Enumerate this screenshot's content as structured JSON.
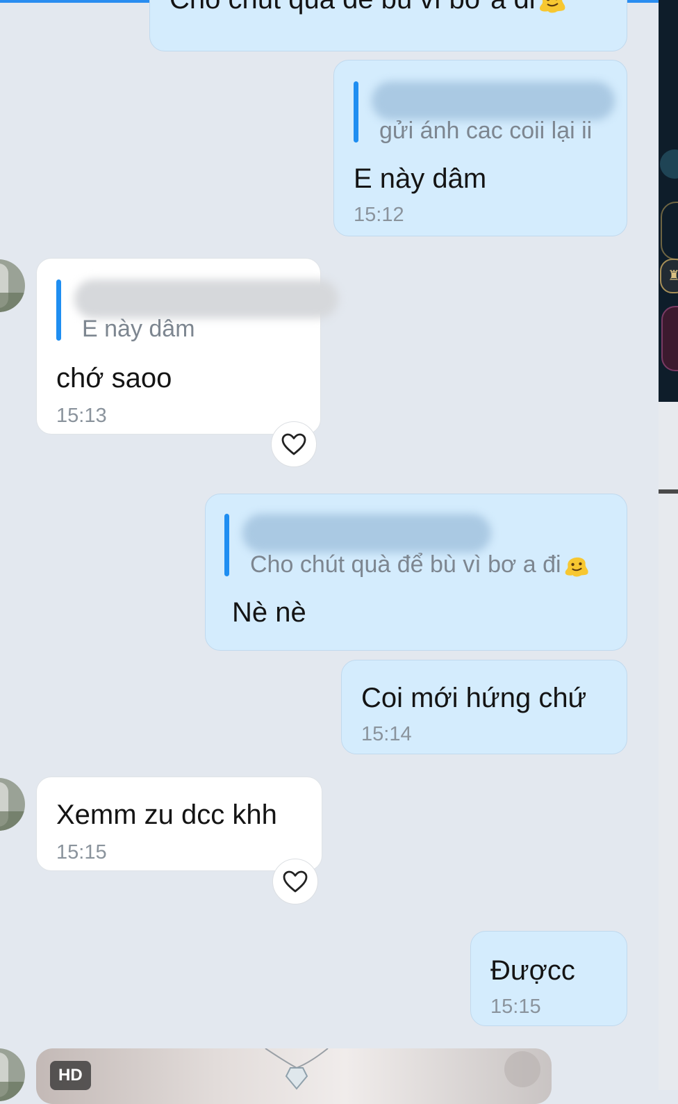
{
  "messages": [
    {
      "side": "sent",
      "text": "Cho chút quà để bù vì bơ a đi",
      "emoji": "melting-face-emoji"
    },
    {
      "side": "sent",
      "reply_to": "gửi ánh cac coii lại ii",
      "text": "E này dâm",
      "time": "15:12"
    },
    {
      "side": "received",
      "reply_to": "E này dâm",
      "text": "chớ saoo",
      "time": "15:13",
      "reaction_icon": "heart-icon"
    },
    {
      "side": "sent",
      "reply_to": "Cho chút quà để bù vì bơ a đi",
      "reply_emoji": "melting-face-emoji",
      "text": "Nè nè"
    },
    {
      "side": "sent",
      "text": "Coi mới hứng chứ",
      "time": "15:14"
    },
    {
      "side": "received",
      "text": "Xemm zu dcc khh",
      "time": "15:15",
      "reaction_icon": "heart-icon"
    },
    {
      "side": "sent",
      "text": "Đượcc",
      "time": "15:15"
    },
    {
      "side": "received",
      "type": "image",
      "badge": "HD"
    }
  ],
  "colors": {
    "background": "#e3e8ef",
    "sent_bubble": "#d4ecfd",
    "received_bubble": "#ffffff",
    "quote_bar": "#1f8ef1",
    "timestamp": "#8a939c"
  }
}
